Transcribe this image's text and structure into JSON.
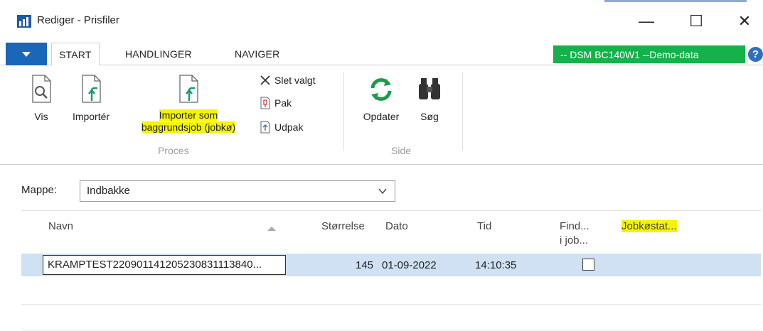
{
  "window": {
    "title": "Rediger - Prisfiler",
    "minimize": "—",
    "maximize": "☐",
    "close": "✕"
  },
  "tabs": [
    {
      "label": "START",
      "active": true
    },
    {
      "label": "HANDLINGER",
      "active": false
    },
    {
      "label": "NAVIGER",
      "active": false
    }
  ],
  "environment": {
    "label": "-- DSM BC140W1 --Demo-data",
    "color": "#14b24a"
  },
  "help": {
    "glyph": "?"
  },
  "ribbon": {
    "proces": {
      "label": "Proces",
      "vis": "Vis",
      "importer": "Importér",
      "importer_job_line1": "Importer som",
      "importer_job_line2": "baggrundsjob (jobkø)",
      "slet": "Slet valgt",
      "pak": "Pak",
      "udpak": "Udpak"
    },
    "side": {
      "label": "Side",
      "opdater": "Opdater",
      "soeg": "Søg"
    }
  },
  "filter": {
    "label": "Mappe:",
    "value": "Indbakke"
  },
  "grid": {
    "headers": {
      "navn": "Navn",
      "stoerrelse": "Størrelse",
      "dato": "Dato",
      "tid": "Tid",
      "find_line1": "Find...",
      "find_line2": "i job...",
      "jobstatus": "Jobkøstat..."
    },
    "rows": [
      {
        "navn": "KRAMPTEST220901141205230831113840...",
        "stoerrelse": "145",
        "dato": "01-09-2022",
        "tid": "14:10:35",
        "find_i_job": false
      }
    ]
  },
  "colors": {
    "highlight": "#f5f500",
    "selection": "#cfe1f3",
    "menu_button": "#1a66b8"
  }
}
